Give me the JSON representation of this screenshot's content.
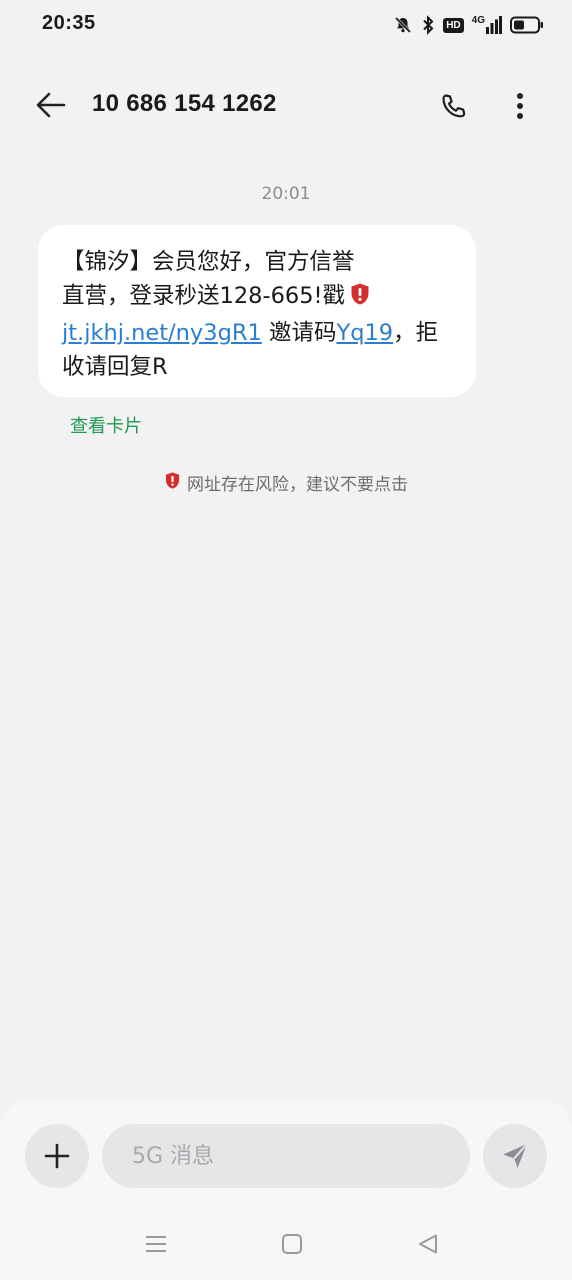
{
  "status_bar": {
    "time": "20:35",
    "icons": [
      "mute-icon",
      "bluetooth-icon",
      "hd-icon",
      "4g-signal-icon",
      "battery-icon"
    ],
    "hd_label": "HD",
    "network_label": "4G"
  },
  "header": {
    "title": "10 686 154 1262",
    "back_icon": "arrow-left-icon",
    "call_icon": "phone-icon",
    "more_icon": "more-vertical-icon"
  },
  "conversation": {
    "timestamp": "20:01",
    "message": {
      "line1": "【锦汐】会员您好，官方信誉",
      "line2": "直营，登录秒送128-665!戳",
      "link": "jt.jkhj.net/ny3gR1",
      "invite_text": " 邀请码",
      "invite_code": "Yq19",
      "tail1": "，拒",
      "line4": "收请回复R"
    },
    "view_card_label": "查看卡片",
    "warning_text": "网址存在风险，建议不要点击"
  },
  "composer": {
    "placeholder": "5G 消息",
    "add_icon": "plus-icon",
    "send_icon": "send-icon"
  },
  "navigation": {
    "items": [
      "menu-icon",
      "home-icon",
      "back-triangle-icon"
    ]
  },
  "colors": {
    "background": "#f2f2f3",
    "bubble": "#ffffff",
    "link": "#2c7fd0",
    "green_action": "#1f9a52",
    "warning_shield": "#d32f2f"
  }
}
